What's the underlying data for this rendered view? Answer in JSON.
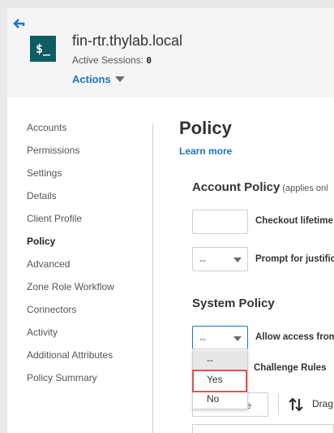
{
  "header": {
    "system_name": "fin-rtr.thylab.local",
    "sessions_label": "Active Sessions:",
    "sessions_count": "0",
    "actions_label": "Actions",
    "system_icon_text": "$_"
  },
  "sidebar": {
    "items": [
      {
        "label": "Accounts"
      },
      {
        "label": "Permissions"
      },
      {
        "label": "Settings"
      },
      {
        "label": "Details"
      },
      {
        "label": "Client Profile"
      },
      {
        "label": "Policy"
      },
      {
        "label": "Advanced"
      },
      {
        "label": "Zone Role Workflow"
      },
      {
        "label": "Connectors"
      },
      {
        "label": "Activity"
      },
      {
        "label": "Additional Attributes"
      },
      {
        "label": "Policy Summary"
      }
    ],
    "active": "Policy"
  },
  "main": {
    "title": "Policy",
    "learn_more": "Learn more",
    "account_policy": {
      "title": "Account Policy",
      "note": "(applies onl",
      "checkout_label": "Checkout lifetime",
      "prompt_select_value": "--",
      "prompt_label": "Prompt for justific"
    },
    "system_policy": {
      "title": "System Policy",
      "allow_select_value": "--",
      "allow_label": "Allow access from",
      "challenge_label": "Challenge Rules"
    },
    "dropdown_options": [
      "--",
      "Yes",
      "No"
    ],
    "hovered_option": "--",
    "partial_button_text": "e",
    "drag_label": "Drag"
  },
  "colors": {
    "accent": "#1a73c7",
    "icon_bg": "#0e5d64",
    "highlight": "#e05252"
  }
}
